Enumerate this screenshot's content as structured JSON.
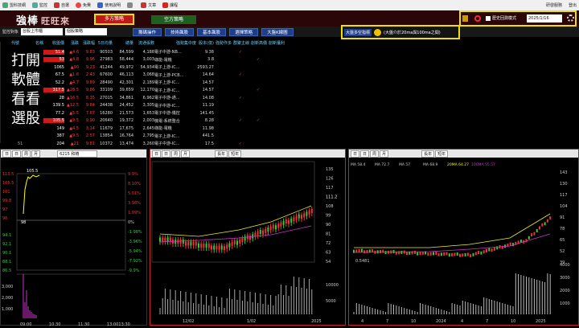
{
  "topbar": {
    "items": [
      "盟科技網",
      "監控",
      "自選",
      "免費",
      "使用說明",
      "",
      "文章",
      "課程"
    ],
    "right": "研發服務",
    "exit": "登出"
  },
  "logo": {
    "main": "強棒",
    "sub": "旺旺來"
  },
  "tabs": [
    "多方策略",
    "空方策略"
  ],
  "header_right": {
    "checkbox": "歷史回測模式",
    "date": "2025/1/16"
  },
  "filter": {
    "label": "監控對象",
    "market": "台股上市櫃",
    "type": "個股策略",
    "buttons": [
      "籌碼操作",
      "技術飆股",
      "基本飆股",
      "選擇策略",
      "大盤K線圖"
    ]
  },
  "strategy": {
    "label": "大盤多空指標",
    "text": "(大盤介於20ma與100ma之間)"
  },
  "table": {
    "headers": [
      "代號",
      "名稱",
      "收盤價",
      "漲跌",
      "漲跌幅",
      "5日均量",
      "總量",
      "流通張數",
      "強勢集中度",
      "股本(億)",
      "強勢作多",
      "群聚主線",
      "創新高價",
      "創新獲利"
    ],
    "rows": [
      [
        "",
        "",
        "51.4",
        "▲4.6",
        "9.83",
        "90503",
        "84,599",
        "4,188",
        "電子中游-NB...",
        "9.38"
      ],
      [
        "",
        "",
        "53",
        "▲4.8",
        "9.96",
        "27983",
        "58,444",
        "3,003",
        "綠能-電機",
        "3.8"
      ],
      [
        "",
        "",
        "1065",
        "▲90",
        "9.23",
        "41244",
        "49,972",
        "54,934",
        "電子上游-IC...",
        "2593.27"
      ],
      [
        "",
        "",
        "67.5",
        "▲1.6",
        "2.43",
        "67600",
        "46,113",
        "3,068",
        "電子上游-PCB...",
        "14.64"
      ],
      [
        "",
        "",
        "52.2",
        "▲4.7",
        "9.89",
        "28490",
        "42,301",
        "2,189",
        "電子上游-IC...",
        "14.57"
      ],
      [
        "",
        "",
        "317.5",
        "▲28.5",
        "9.86",
        "33109",
        "39,659",
        "12,170",
        "電子上游-IC...",
        "14.57"
      ],
      [
        "",
        "",
        "28",
        "▲16.5",
        "8.35",
        "27015",
        "34,861",
        "6,962",
        "電子中游-通...",
        "14.08"
      ],
      [
        "",
        "",
        "139.5",
        "▲12.5",
        "9.84",
        "24438",
        "24,452",
        "3,305",
        "電子中游-IC...",
        "11.19"
      ],
      [
        "",
        "",
        "77.2",
        "▲5.5",
        "7.67",
        "16280",
        "21,573",
        "1,653",
        "電子中游-儀控",
        "141.45"
      ],
      [
        "",
        "",
        "105.5",
        "▲9.5",
        "9.90",
        "20640",
        "19,372",
        "2,003",
        "機電-系統整合",
        "8.28"
      ],
      [
        "",
        "",
        "149",
        "▲4.5",
        "3.14",
        "11679",
        "17,675",
        "2,645",
        "綠能-電機",
        "11.98"
      ],
      [
        "",
        "",
        "387",
        "▲9.5",
        "2.57",
        "13854",
        "16,764",
        "2,795",
        "電子上游-IC...",
        "441.5"
      ],
      [
        "",
        "",
        "204",
        "▲21",
        "9.81",
        "10372",
        "13,474",
        "3,260",
        "電子中游-IC...",
        "17.5"
      ]
    ],
    "count": "51"
  },
  "slogan": [
    "打開",
    "軟體",
    "看看",
    "選股"
  ],
  "panel1": {
    "tools": [
      "日",
      "日",
      "周",
      "月"
    ],
    "code": "6215 和椿",
    "label": "和椿",
    "yvals": [
      "110.5",
      "105.5",
      "101",
      "99.8",
      "97",
      "96"
    ],
    "pct": [
      "9.9%",
      "8.10%",
      "5.01%",
      "3.98%",
      "1.99%",
      "0%",
      "-1.98%",
      "-3.96%",
      "-5.94%",
      "-7.92%",
      "-9.9%"
    ],
    "yvals_low": [
      "94.1",
      "92.1",
      "90.1",
      "88.1",
      "86.5"
    ],
    "vol": [
      "3,000",
      "2,000",
      "1,000"
    ],
    "times": [
      "09:00",
      "10:30",
      "11:30",
      "13:0013:30"
    ],
    "high": "105.5",
    "low": "98"
  },
  "panel2": {
    "tools": [
      "日",
      "日",
      "周",
      "月"
    ],
    "cb": [
      "長年",
      "短年"
    ],
    "yvals": [
      "135",
      "126",
      "117",
      "111.2",
      "108",
      "99",
      "90",
      "81",
      "72",
      "63",
      "54"
    ],
    "vol_y": [
      "10000",
      "5000"
    ],
    "dates": [
      "12/02",
      "1/02",
      "2025"
    ]
  },
  "panel3": {
    "tools": [
      "日",
      "日",
      "周",
      "月"
    ],
    "cb": [
      "長年",
      "短年"
    ],
    "ma": [
      "MA 58.4",
      "MA 72.7",
      "MA 57",
      "MA 68.9",
      "20MA 64.27",
      "100MA 55.57"
    ],
    "yvals": [
      "143",
      "130",
      "117",
      "104",
      "91",
      "78",
      "65",
      "52",
      "39"
    ],
    "vol_y": [
      "4000",
      "3000",
      "2000",
      "1000"
    ],
    "dates": [
      "4",
      "7",
      "10",
      "2024",
      "4",
      "7",
      "10",
      "2025"
    ],
    "vlabel": "0.5481"
  }
}
